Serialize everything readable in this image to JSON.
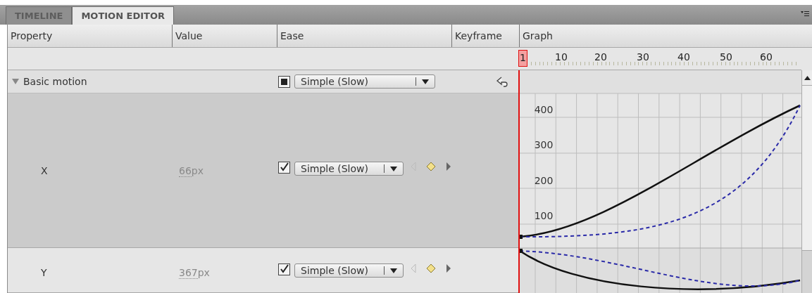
{
  "tabs": [
    {
      "label": "TIMELINE",
      "selected": false
    },
    {
      "label": "MOTION EDITOR",
      "selected": true
    }
  ],
  "columns": [
    "Property",
    "Value",
    "Ease",
    "Keyframe",
    "Graph"
  ],
  "ruler": {
    "ticks": [
      "1",
      "10",
      "20",
      "30",
      "40",
      "50",
      "60"
    ]
  },
  "category": {
    "label": "Basic motion",
    "expanded": true,
    "ease_indeterminate": true,
    "ease": "Simple (Slow)"
  },
  "properties": [
    {
      "name": "X",
      "value": "66",
      "unit": "px",
      "ease_checked": true,
      "ease": "Simple (Slow)",
      "selected": true
    },
    {
      "name": "Y",
      "value": "367",
      "unit": "px",
      "ease_checked": true,
      "ease": "Simple (Slow)",
      "selected": false
    }
  ],
  "graph": {
    "y_labels": [
      "400",
      "300",
      "200",
      "100"
    ]
  }
}
